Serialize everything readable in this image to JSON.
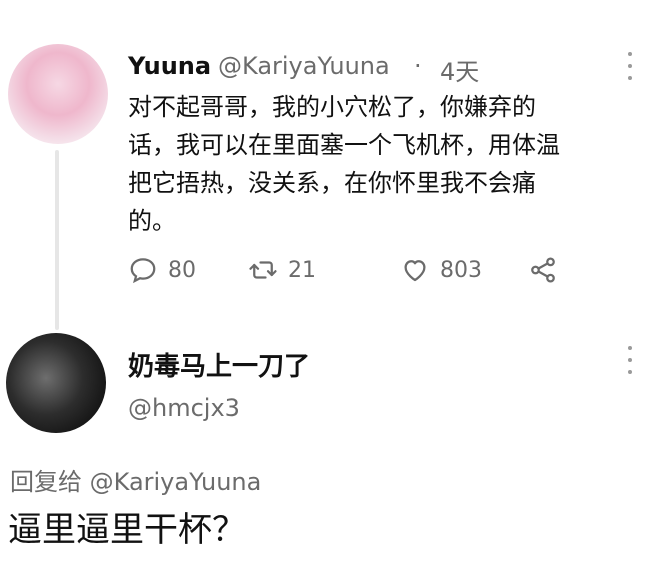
{
  "tweet": {
    "author": "Yuuna",
    "handle": "@KariyaYuuna",
    "separator": "·",
    "time": "4天",
    "text": "对不起哥哥，我的小穴松了，你嫌弃的\n话，我可以在里面塞一个飞机杯，用体温\n把它捂热，没关系，在你怀里我不会痛\n的。",
    "stats": {
      "replies": "80",
      "retweets": "21",
      "likes": "803"
    },
    "icons": [
      "reply-icon",
      "retweet-icon",
      "like-icon",
      "share-icon",
      "more-icon"
    ]
  },
  "reply": {
    "author": "奶毒马上一刀了",
    "handle": "@hmcjx3",
    "reply_to": "回复给 @KariyaYuuna",
    "text": "逼里逼里干杯？"
  },
  "colors": {
    "text": "#111111",
    "muted": "#6b6b6b",
    "thread_line": "#e6e6e6",
    "background": "#ffffff"
  }
}
